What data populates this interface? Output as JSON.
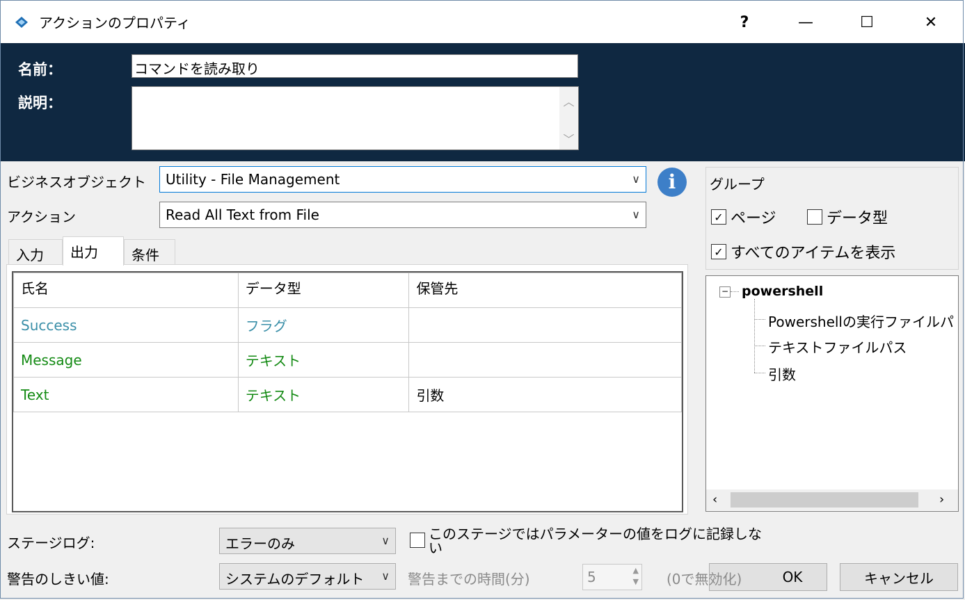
{
  "window": {
    "title": "アクションのプロパティ",
    "help": "?",
    "minimize": "—",
    "maximize": "☐",
    "close": "✕"
  },
  "header": {
    "name_label": "名前：",
    "name_value": "コマンドを読み取り",
    "desc_label": "説明：",
    "desc_value": ""
  },
  "form": {
    "bo_label": "ビジネスオブジェクト",
    "bo_value": "Utility - File Management",
    "action_label": "アクション",
    "action_value": "Read All Text from File"
  },
  "tabs": [
    "入力",
    "出力",
    "条件"
  ],
  "grid": {
    "headers": [
      "氏名",
      "データ型",
      "保管先"
    ],
    "rows": [
      {
        "name": "Success",
        "type": "フラグ",
        "store": "",
        "color": "#3a8fa8"
      },
      {
        "name": "Message",
        "type": "テキスト",
        "store": "",
        "color": "#138a13"
      },
      {
        "name": "Text",
        "type": "テキスト",
        "store": "引数",
        "color": "#138a13"
      }
    ]
  },
  "group": {
    "title": "グループ",
    "page": "ページ",
    "page_checked": true,
    "datatype": "データ型",
    "datatype_checked": false,
    "show_all": "すべてのアイテムを表示",
    "show_all_checked": true
  },
  "tree": {
    "root": "powershell",
    "children": [
      "Powershellの実行ファイルパ",
      "テキストファイルパス",
      "引数"
    ]
  },
  "bottom": {
    "stagelog_label": "ステージログ:",
    "stagelog_value": "エラーのみ",
    "nolog_label": "このステージではパラメーターの値をログに記録しな",
    "nolog_label2": "い",
    "warn_label": "警告のしきい値:",
    "warn_value": "システムのデフォルト",
    "time_label": "警告までの時間(分)",
    "time_value": "5",
    "disable_hint": "(0で無効化)",
    "ok": "OK",
    "cancel": "キャンセル"
  }
}
